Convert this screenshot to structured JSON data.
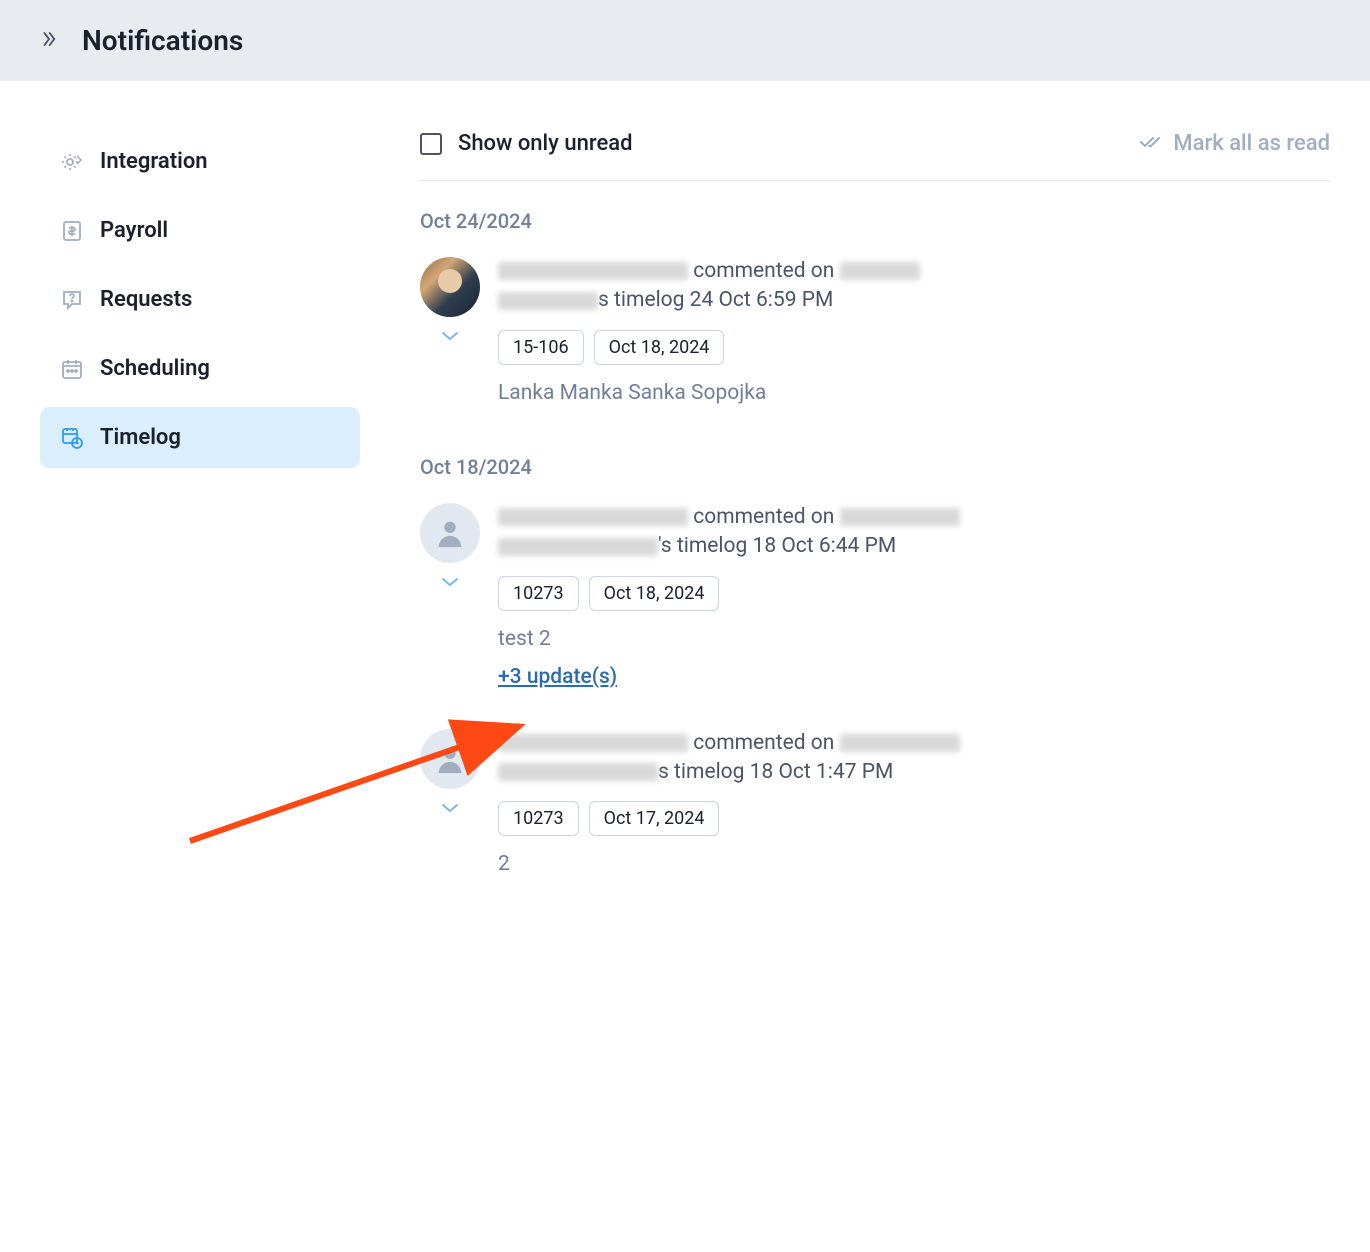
{
  "header": {
    "title": "Notifications"
  },
  "sidebar": {
    "items": [
      {
        "id": "integration",
        "label": "Integration"
      },
      {
        "id": "payroll",
        "label": "Payroll"
      },
      {
        "id": "requests",
        "label": "Requests"
      },
      {
        "id": "scheduling",
        "label": "Scheduling"
      },
      {
        "id": "timelog",
        "label": "Timelog"
      }
    ],
    "active": "timelog"
  },
  "filters": {
    "unread_label": "Show only unread",
    "mark_read_label": "Mark all as read"
  },
  "groups": [
    {
      "date": "Oct 24/2024",
      "notifications": [
        {
          "avatar_type": "photo",
          "action": "commented on",
          "suffix1": "s timelog",
          "timestamp": "24 Oct 6:59 PM",
          "tags": [
            "15-106",
            "Oct 18, 2024"
          ],
          "comment": "Lanka Manka Sanka Sopojka",
          "updates": null
        }
      ]
    },
    {
      "date": "Oct 18/2024",
      "notifications": [
        {
          "avatar_type": "placeholder",
          "action": "commented on",
          "suffix1": "'s timelog",
          "timestamp": "18 Oct 6:44 PM",
          "tags": [
            "10273",
            "Oct 18, 2024"
          ],
          "comment": "test 2",
          "updates": "+3 update(s)"
        },
        {
          "avatar_type": "placeholder",
          "action": "commented on",
          "suffix1": "s timelog",
          "timestamp": "18 Oct 1:47 PM",
          "tags": [
            "10273",
            "Oct 17, 2024"
          ],
          "comment": "2",
          "updates": null
        }
      ]
    }
  ]
}
